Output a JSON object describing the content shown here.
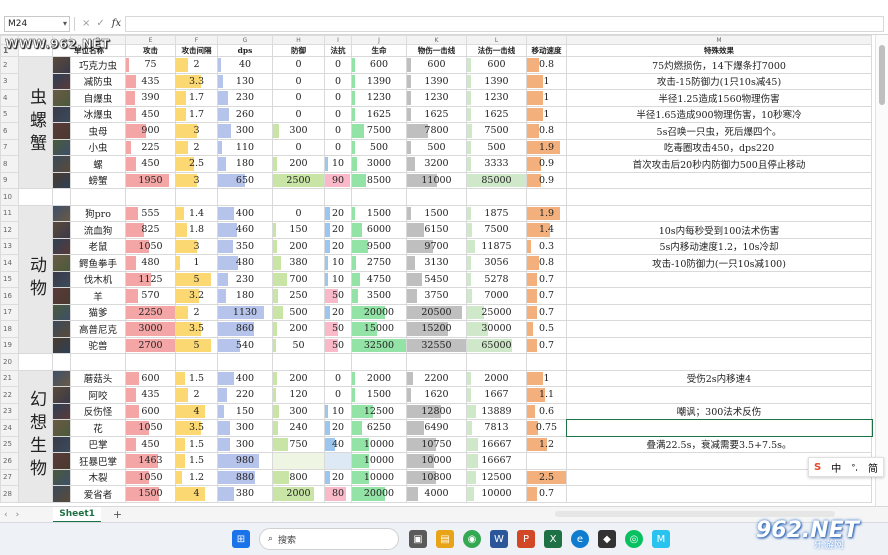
{
  "formula_bar": {
    "cell_ref": "M24",
    "fx_label": "fx",
    "cancel_icon": "×",
    "confirm_icon": "✓"
  },
  "watermark_top": "WWW.962.NET",
  "watermark_logo": {
    "text": "962.NET",
    "sub": "乐游网"
  },
  "columns": [
    "",
    "",
    "",
    "D",
    "E",
    "F",
    "G",
    "H",
    "I",
    "J",
    "K",
    "L",
    "M"
  ],
  "headers": [
    "",
    "单位名称",
    "攻击",
    "攻击间隔",
    "dps",
    "防御",
    "法抗",
    "生命",
    "物伤一击线",
    "法伤一击线",
    "移动速度",
    "特殊效果"
  ],
  "colors": {
    "attack": "#f4a6a6",
    "interval": "#fcd872",
    "dps": "#b6c3ea",
    "def": "#c9e5a6",
    "res": "#9dc6ee",
    "hp": "#93e3a6",
    "phys": "#bfbfbf",
    "magic": "#cfe8c9",
    "move": "#f3b07c",
    "pink": "#f9b9c8"
  },
  "groups": [
    {
      "name": "虫螺蟹",
      "rows": [
        {
          "n": "2",
          "name": "巧克力虫",
          "atk": "75",
          "int": "2",
          "dps": "40",
          "def": "0",
          "res": "0",
          "hp": "600",
          "phys": "600",
          "magic": "600",
          "mv": "0.8",
          "fx": "75灼燃损伤，14下爆条打7000",
          "atkf": 0.04,
          "intf": 0.3,
          "dpsf": 0.03,
          "deff": 0,
          "resf": 0,
          "hpf": 0.02,
          "physf": 0.02,
          "magf": 0.01,
          "mvf": 0.3
        },
        {
          "n": "3",
          "name": "减防虫",
          "atk": "435",
          "int": "3.3",
          "dps": "130",
          "def": "0",
          "res": "0",
          "hp": "1390",
          "phys": "1390",
          "magic": "1390",
          "mv": "1",
          "fx": "攻击-15防御力(1只10s减45)",
          "atkf": 0.2,
          "intf": 0.6,
          "dpsf": 0.1,
          "deff": 0,
          "resf": 0,
          "hpf": 0.04,
          "physf": 0.06,
          "magf": 0.02,
          "mvf": 0.4
        },
        {
          "n": "4",
          "name": "自爆虫",
          "atk": "390",
          "int": "1.7",
          "dps": "230",
          "def": "0",
          "res": "0",
          "hp": "1230",
          "phys": "1230",
          "magic": "1230",
          "mv": "1",
          "fx": "半径1.25造成1560物理伤害",
          "atkf": 0.18,
          "intf": 0.25,
          "dpsf": 0.18,
          "deff": 0,
          "resf": 0,
          "hpf": 0.04,
          "physf": 0.05,
          "magf": 0.02,
          "mvf": 0.4
        },
        {
          "n": "5",
          "name": "冰爆虫",
          "atk": "450",
          "int": "1.7",
          "dps": "260",
          "def": "0",
          "res": "0",
          "hp": "1625",
          "phys": "1625",
          "magic": "1625",
          "mv": "1",
          "fx": "半径1.65造成900物理伤害，10秒寒冷",
          "atkf": 0.2,
          "intf": 0.25,
          "dpsf": 0.2,
          "deff": 0,
          "resf": 0,
          "hpf": 0.05,
          "physf": 0.07,
          "magf": 0.02,
          "mvf": 0.4
        },
        {
          "n": "6",
          "name": "虫母",
          "atk": "900",
          "int": "3",
          "dps": "300",
          "def": "300",
          "res": "0",
          "hp": "7500",
          "phys": "7800",
          "magic": "7500",
          "mv": "0.8",
          "fx": "5s召唤一只虫，死后爆四个。",
          "atkf": 0.4,
          "intf": 0.5,
          "dpsf": 0.24,
          "deff": 0.12,
          "resf": 0,
          "hpf": 0.23,
          "physf": 0.35,
          "magf": 0.09,
          "mvf": 0.3
        },
        {
          "n": "7",
          "name": "小虫",
          "atk": "225",
          "int": "2",
          "dps": "110",
          "def": "0",
          "res": "0",
          "hp": "500",
          "phys": "500",
          "magic": "500",
          "mv": "1.9",
          "fx": "吃毒圈攻击450，dps220",
          "atkf": 0.1,
          "intf": 0.3,
          "dpsf": 0.08,
          "deff": 0,
          "resf": 0,
          "hpf": 0.01,
          "physf": 0.02,
          "magf": 0.01,
          "mvf": 0.85
        },
        {
          "n": "8",
          "name": "螺",
          "atk": "450",
          "int": "2.5",
          "dps": "180",
          "def": "200",
          "res": "10",
          "hp": "3000",
          "phys": "3200",
          "magic": "3333",
          "mv": "0.9",
          "fx": "首次攻击后20秒内防御力500且停止移动",
          "atkf": 0.2,
          "intf": 0.45,
          "dpsf": 0.15,
          "deff": 0.08,
          "resf": 0.1,
          "hpf": 0.09,
          "physf": 0.14,
          "magf": 0.04,
          "mvf": 0.35
        },
        {
          "n": "9",
          "name": "螃蟹",
          "atk": "1950",
          "int": "3",
          "dps": "650",
          "def": "2500",
          "res": "90",
          "hp": "8500",
          "phys": "11000",
          "magic": "85000",
          "mv": "0.9",
          "fx": "",
          "atkf": 0.88,
          "intf": 0.5,
          "dpsf": 0.5,
          "deff": 1,
          "resf": 0.95,
          "hpf": 0.26,
          "physf": 0.5,
          "magf": 1,
          "mvf": 0.35,
          "pinkres": true
        }
      ]
    },
    {
      "name": "动物",
      "rows": [
        {
          "n": "11",
          "name": "狗pro",
          "atk": "555",
          "int": "1.4",
          "dps": "400",
          "def": "0",
          "res": "20",
          "hp": "1500",
          "phys": "1500",
          "magic": "1875",
          "mv": "1.9",
          "fx": "",
          "atkf": 0.25,
          "intf": 0.2,
          "dpsf": 0.3,
          "deff": 0,
          "resf": 0.2,
          "hpf": 0.05,
          "physf": 0.07,
          "magf": 0.02,
          "mvf": 0.85
        },
        {
          "n": "12",
          "name": "流血狗",
          "atk": "825",
          "int": "1.8",
          "dps": "460",
          "def": "150",
          "res": "20",
          "hp": "6000",
          "phys": "6150",
          "magic": "7500",
          "mv": "1.4",
          "fx": "10s内每秒受到100法术伤害",
          "atkf": 0.37,
          "intf": 0.27,
          "dpsf": 0.35,
          "deff": 0.06,
          "resf": 0.2,
          "hpf": 0.18,
          "physf": 0.28,
          "magf": 0.09,
          "mvf": 0.6
        },
        {
          "n": "13",
          "name": "老鼠",
          "atk": "1050",
          "int": "3",
          "dps": "350",
          "def": "200",
          "res": "20",
          "hp": "9500",
          "phys": "9700",
          "magic": "11875",
          "mv": "0.3",
          "fx": "5s内移动速度1.2，10s冷却",
          "atkf": 0.47,
          "intf": 0.5,
          "dpsf": 0.27,
          "deff": 0.08,
          "resf": 0.2,
          "hpf": 0.29,
          "physf": 0.44,
          "magf": 0.14,
          "mvf": 0.1
        },
        {
          "n": "14",
          "name": "鳄鱼拳手",
          "atk": "480",
          "int": "1",
          "dps": "480",
          "def": "380",
          "res": "10",
          "hp": "2750",
          "phys": "3130",
          "magic": "3056",
          "mv": "0.8",
          "fx": "攻击-10防御力(一只10s减100)",
          "atkf": 0.21,
          "intf": 0.1,
          "dpsf": 0.37,
          "deff": 0.15,
          "resf": 0.1,
          "hpf": 0.08,
          "physf": 0.14,
          "magf": 0.04,
          "mvf": 0.3
        },
        {
          "n": "15",
          "name": "伐木机",
          "atk": "1125",
          "int": "5",
          "dps": "230",
          "def": "700",
          "res": "10",
          "hp": "4750",
          "phys": "5450",
          "magic": "5278",
          "mv": "0.7",
          "fx": "",
          "atkf": 0.5,
          "intf": 0.85,
          "dpsf": 0.18,
          "deff": 0.28,
          "resf": 0.1,
          "hpf": 0.15,
          "physf": 0.25,
          "magf": 0.06,
          "mvf": 0.25
        },
        {
          "n": "16",
          "name": "羊",
          "atk": "570",
          "int": "3.2",
          "dps": "180",
          "def": "250",
          "res": "50",
          "hp": "3500",
          "phys": "3750",
          "magic": "7000",
          "mv": "0.7",
          "fx": "",
          "atkf": 0.25,
          "intf": 0.55,
          "dpsf": 0.14,
          "deff": 0.1,
          "resf": 0.5,
          "hpf": 0.11,
          "physf": 0.17,
          "magf": 0.08,
          "mvf": 0.25,
          "pinkres": true
        },
        {
          "n": "17",
          "name": "猫爹",
          "atk": "2250",
          "int": "2",
          "dps": "1130",
          "def": "500",
          "res": "20",
          "hp": "20000",
          "phys": "20500",
          "magic": "25000",
          "mv": "0.7",
          "fx": "",
          "atkf": 1,
          "intf": 0.3,
          "dpsf": 0.86,
          "deff": 0.2,
          "resf": 0.2,
          "hpf": 0.61,
          "physf": 0.93,
          "magf": 0.29,
          "mvf": 0.25
        },
        {
          "n": "18",
          "name": "高普尼克",
          "atk": "3000",
          "int": "3.5",
          "dps": "860",
          "def": "200",
          "res": "50",
          "hp": "15000",
          "phys": "15200",
          "magic": "30000",
          "mv": "0.5",
          "fx": "",
          "atkf": 1,
          "intf": 0.6,
          "dpsf": 0.66,
          "deff": 0.08,
          "resf": 0.5,
          "hpf": 0.46,
          "physf": 0.69,
          "magf": 0.35,
          "mvf": 0.15,
          "pinkres": true
        },
        {
          "n": "19",
          "name": "驼兽",
          "atk": "2700",
          "int": "5",
          "dps": "540",
          "def": "50",
          "res": "50",
          "hp": "32500",
          "phys": "32550",
          "magic": "65000",
          "mv": "0.7",
          "fx": "",
          "atkf": 1,
          "intf": 0.85,
          "dpsf": 0.41,
          "deff": 0.02,
          "resf": 0.5,
          "hpf": 1,
          "physf": 1,
          "magf": 0.76,
          "mvf": 0.25,
          "pinkres": true
        }
      ]
    },
    {
      "name": "幻想生物",
      "rows": [
        {
          "n": "21",
          "name": "蘑菇头",
          "atk": "600",
          "int": "1.5",
          "dps": "400",
          "def": "200",
          "res": "0",
          "hp": "2000",
          "phys": "2200",
          "magic": "2000",
          "mv": "1",
          "fx": "受伤2s内移速4",
          "atkf": 0.27,
          "intf": 0.22,
          "dpsf": 0.3,
          "deff": 0.08,
          "resf": 0,
          "hpf": 0.06,
          "physf": 0.1,
          "magf": 0.02,
          "mvf": 0.4
        },
        {
          "n": "22",
          "name": "阿咬",
          "atk": "435",
          "int": "2",
          "dps": "220",
          "def": "120",
          "res": "0",
          "hp": "1500",
          "phys": "1620",
          "magic": "1667",
          "mv": "1.1",
          "fx": "",
          "atkf": 0.2,
          "intf": 0.3,
          "dpsf": 0.17,
          "deff": 0.05,
          "resf": 0,
          "hpf": 0.05,
          "physf": 0.07,
          "magf": 0.02,
          "mvf": 0.45
        },
        {
          "n": "23",
          "name": "反伤怪",
          "atk": "600",
          "int": "4",
          "dps": "150",
          "def": "300",
          "res": "10",
          "hp": "12500",
          "phys": "12800",
          "magic": "13889",
          "mv": "0.6",
          "fx": "嘲讽；300法术反伤",
          "atkf": 0.27,
          "intf": 0.7,
          "dpsf": 0.12,
          "deff": 0.12,
          "resf": 0.1,
          "hpf": 0.38,
          "physf": 0.58,
          "magf": 0.16,
          "mvf": 0.2
        },
        {
          "n": "24",
          "name": "花",
          "atk": "1050",
          "int": "3.5",
          "dps": "300",
          "def": "240",
          "res": "20",
          "hp": "6250",
          "phys": "6490",
          "magic": "7813",
          "mv": "0.75",
          "fx": "",
          "atkf": 0.47,
          "intf": 0.6,
          "dpsf": 0.23,
          "deff": 0.1,
          "resf": 0.2,
          "hpf": 0.19,
          "physf": 0.29,
          "magf": 0.09,
          "mvf": 0.27,
          "sel": true
        },
        {
          "n": "25",
          "name": "巴掌",
          "atk": "450",
          "int": "1.5",
          "dps": "300",
          "def": "750",
          "res": "40",
          "hp": "10000",
          "phys": "10750",
          "magic": "16667",
          "mv": "1.2",
          "fx": "叠满22.5s，衰减需要3.5+7.5s。",
          "atkf": 0.2,
          "intf": 0.22,
          "dpsf": 0.23,
          "deff": 0.3,
          "resf": 0.4,
          "hpf": 0.31,
          "physf": 0.49,
          "magf": 0.19,
          "mvf": 0.5
        },
        {
          "n": "26",
          "name": "狂暴巴掌",
          "atk": "1463",
          "int": "1.5",
          "dps": "980",
          "def": "",
          "res": "",
          "hp": "10000",
          "phys": "10000",
          "magic": "16667",
          "mv": "",
          "fx": "",
          "atkf": 0.65,
          "intf": 0.22,
          "dpsf": 0.75,
          "deff": 0,
          "resf": 0,
          "hpf": 0.31,
          "physf": 0.45,
          "magf": 0.19,
          "mvf": 0,
          "merged": true
        },
        {
          "n": "27",
          "name": "木裂",
          "atk": "1050",
          "int": "1.2",
          "dps": "880",
          "def": "800",
          "res": "20",
          "hp": "10000",
          "phys": "10800",
          "magic": "12500",
          "mv": "2.5",
          "fx": "",
          "atkf": 0.47,
          "intf": 0.15,
          "dpsf": 0.68,
          "deff": 0.32,
          "resf": 0.2,
          "hpf": 0.31,
          "physf": 0.49,
          "magf": 0.15,
          "mvf": 1
        },
        {
          "n": "28",
          "name": "爱省者",
          "atk": "1500",
          "int": "4",
          "dps": "380",
          "def": "2000",
          "res": "80",
          "hp": "20000",
          "phys": "4000",
          "magic": "10000",
          "mv": "0.7",
          "fx": "",
          "atkf": 0.67,
          "intf": 0.7,
          "dpsf": 0.29,
          "deff": 0.8,
          "resf": 0.8,
          "hpf": 0.61,
          "physf": 0.18,
          "magf": 0.12,
          "mvf": 0.25,
          "pinkres": true
        }
      ]
    }
  ],
  "sheet_tab": "Sheet1",
  "taskbar": {
    "search": "搜索"
  },
  "ime": {
    "lang": "中",
    "mode": "简"
  }
}
